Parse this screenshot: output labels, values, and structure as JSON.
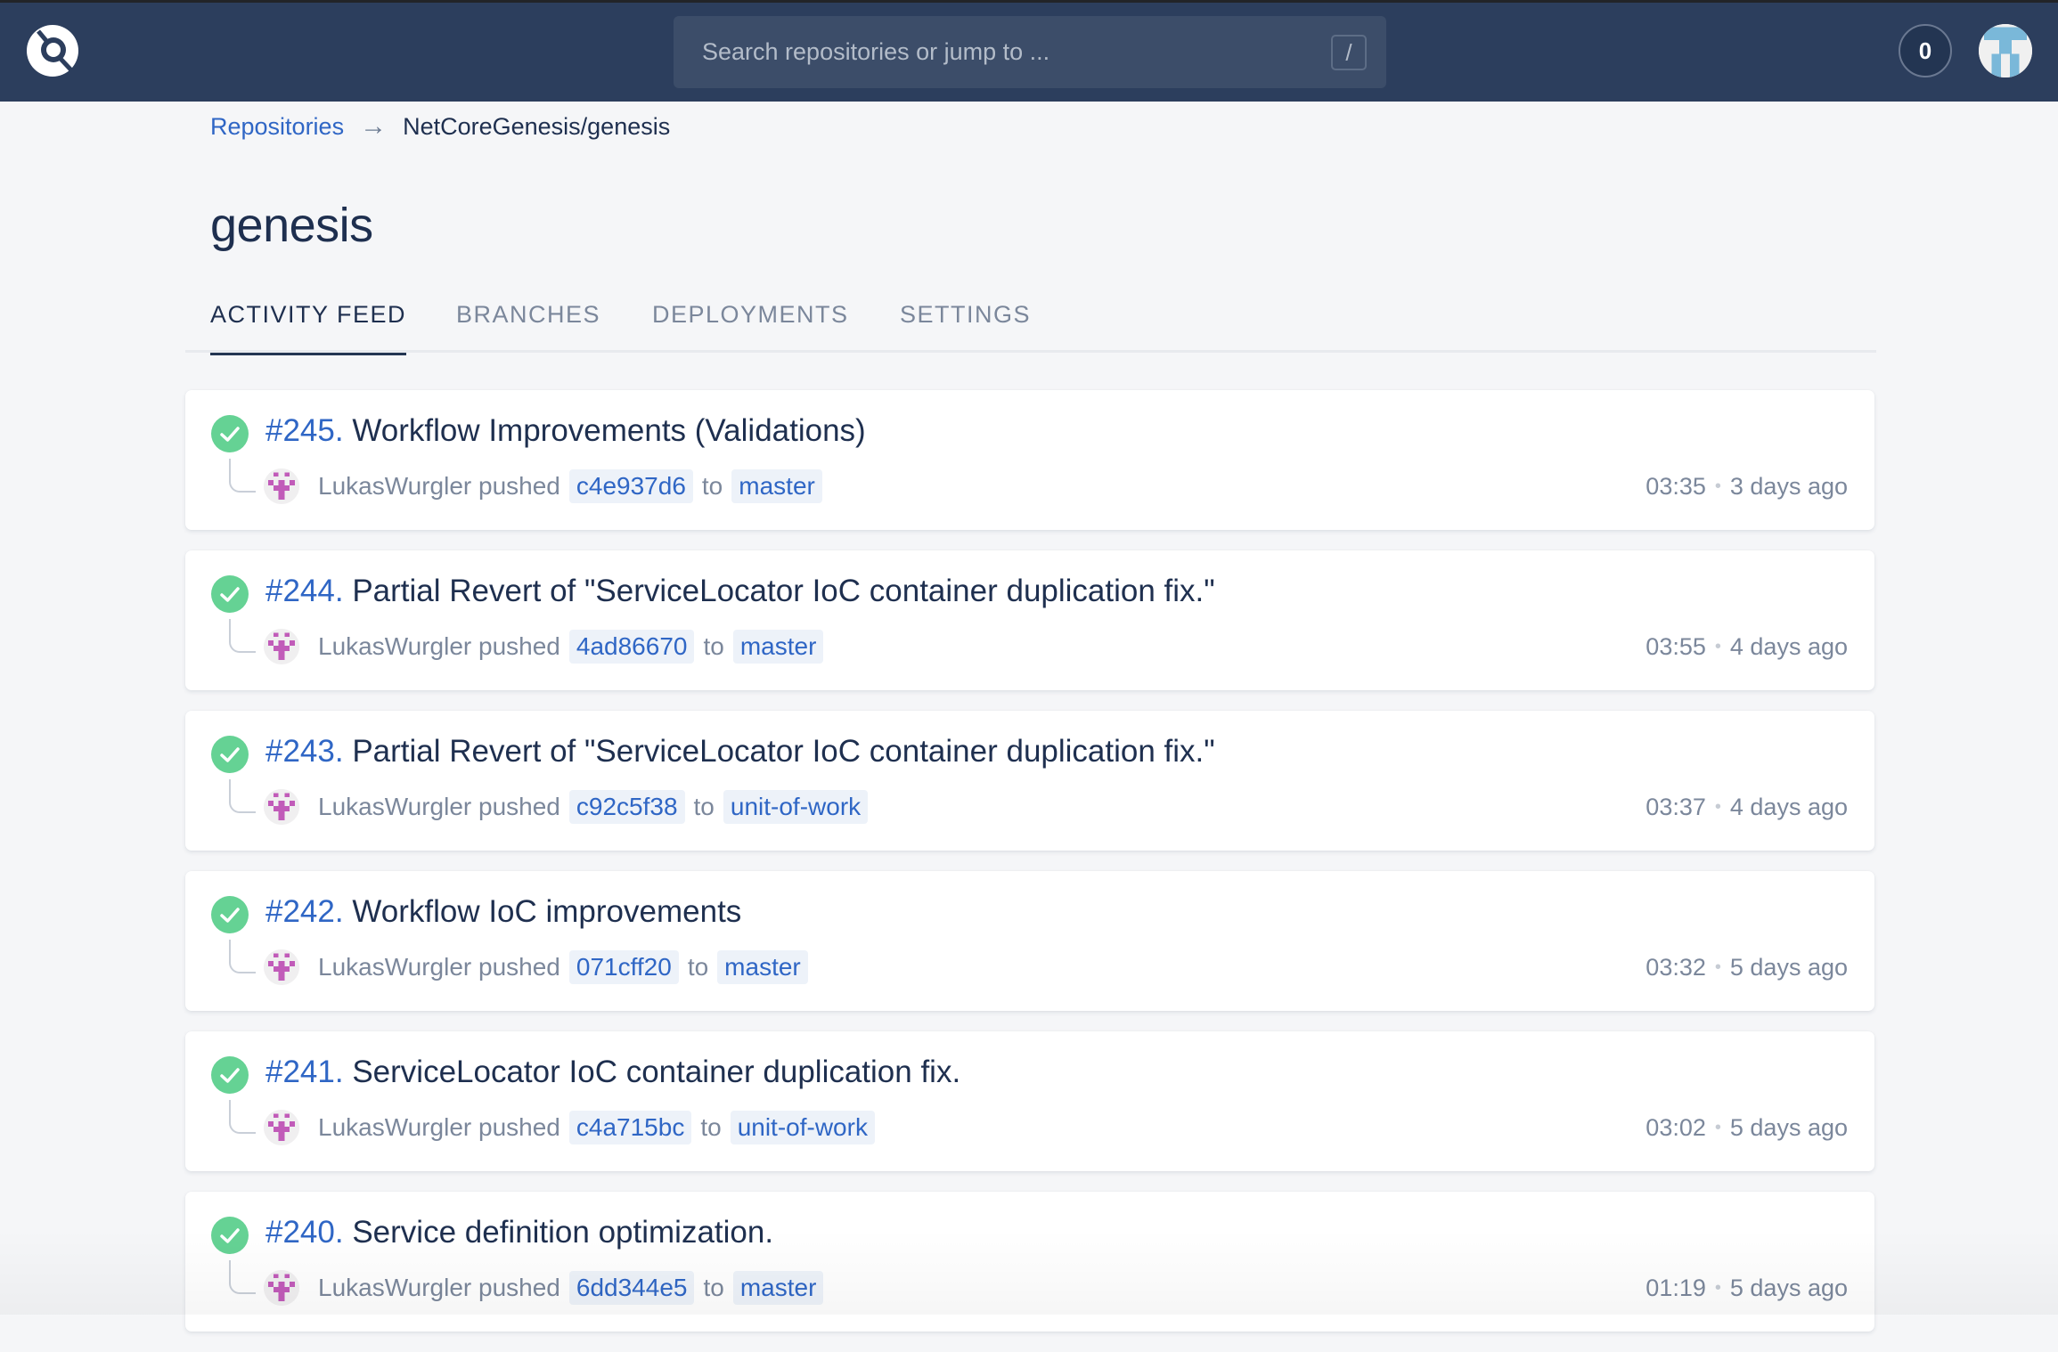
{
  "header": {
    "logo_icon": "app-logo-icon",
    "search": {
      "placeholder": "Search repositories or jump to ...",
      "value": "",
      "shortcut_key": "/"
    },
    "notification_count": "0",
    "user_avatar_icon": "identicon-avatar"
  },
  "breadcrumb": {
    "root_label": "Repositories",
    "separator": "→",
    "current": "NetCoreGenesis/genesis"
  },
  "page_title": "genesis",
  "tabs": [
    {
      "label": "ACTIVITY FEED",
      "active": true
    },
    {
      "label": "BRANCHES",
      "active": false
    },
    {
      "label": "DEPLOYMENTS",
      "active": false
    },
    {
      "label": "SETTINGS",
      "active": false
    }
  ],
  "colors": {
    "header_bg": "#2c3e5d",
    "accent_blue": "#2f66c5",
    "success_green": "#65d294",
    "text_dark": "#1e2f4f",
    "text_muted": "#7b879b",
    "identicon_magenta": "#c15bb9"
  },
  "feed": [
    {
      "status": "success",
      "number": "#245.",
      "title": "Workflow Improvements (Validations)",
      "author": "LukasWurgler",
      "action": "pushed",
      "commit": "c4e937d6",
      "to": "to",
      "branch": "master",
      "time": "03:35",
      "relative": "3 days ago"
    },
    {
      "status": "success",
      "number": "#244.",
      "title": "Partial Revert of \"ServiceLocator IoC container duplication fix.\"",
      "author": "LukasWurgler",
      "action": "pushed",
      "commit": "4ad86670",
      "to": "to",
      "branch": "master",
      "time": "03:55",
      "relative": "4 days ago"
    },
    {
      "status": "success",
      "number": "#243.",
      "title": "Partial Revert of \"ServiceLocator IoC container duplication fix.\"",
      "author": "LukasWurgler",
      "action": "pushed",
      "commit": "c92c5f38",
      "to": "to",
      "branch": "unit-of-work",
      "time": "03:37",
      "relative": "4 days ago"
    },
    {
      "status": "success",
      "number": "#242.",
      "title": "Workflow IoC improvements",
      "author": "LukasWurgler",
      "action": "pushed",
      "commit": "071cff20",
      "to": "to",
      "branch": "master",
      "time": "03:32",
      "relative": "5 days ago"
    },
    {
      "status": "success",
      "number": "#241.",
      "title": "ServiceLocator IoC container duplication fix.",
      "author": "LukasWurgler",
      "action": "pushed",
      "commit": "c4a715bc",
      "to": "to",
      "branch": "unit-of-work",
      "time": "03:02",
      "relative": "5 days ago"
    },
    {
      "status": "success",
      "number": "#240.",
      "title": "Service definition optimization.",
      "author": "LukasWurgler",
      "action": "pushed",
      "commit": "6dd344e5",
      "to": "to",
      "branch": "master",
      "time": "01:19",
      "relative": "5 days ago"
    }
  ]
}
